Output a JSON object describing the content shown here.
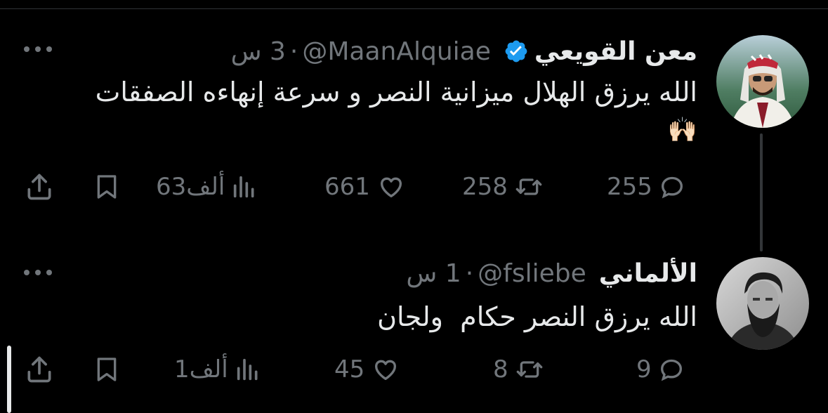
{
  "tweets": [
    {
      "author_name": "معن القويعي",
      "handle": "@MaanAlquiae",
      "separator": "·",
      "time": "3 س",
      "verified": true,
      "text_line1": "الله يرزق الهلال ميزانية النصر و سرعة إنهاءه الصفقات",
      "text_line2": "🙌🏻",
      "replies": "255",
      "retweets": "258",
      "likes": "661",
      "views": "63ألف"
    },
    {
      "author_name": "الألماني",
      "handle": "@fsliebe",
      "separator": "·",
      "time": "1 س",
      "verified": false,
      "text_line1": "الله يرزق النصر حكام  ولجان",
      "replies": "9",
      "retweets": "8",
      "likes": "45",
      "views": "1ألف"
    }
  ],
  "icons": {
    "reply": "reply-icon",
    "retweet": "retweet-icon",
    "like": "like-icon",
    "views": "views-icon",
    "bookmark": "bookmark-icon",
    "share": "share-icon",
    "more": "more-icon",
    "verified": "verified-badge-icon"
  },
  "colors": {
    "background": "#000000",
    "text": "#e7e9ea",
    "muted": "#71767b",
    "verified": "#1d9bf0"
  }
}
